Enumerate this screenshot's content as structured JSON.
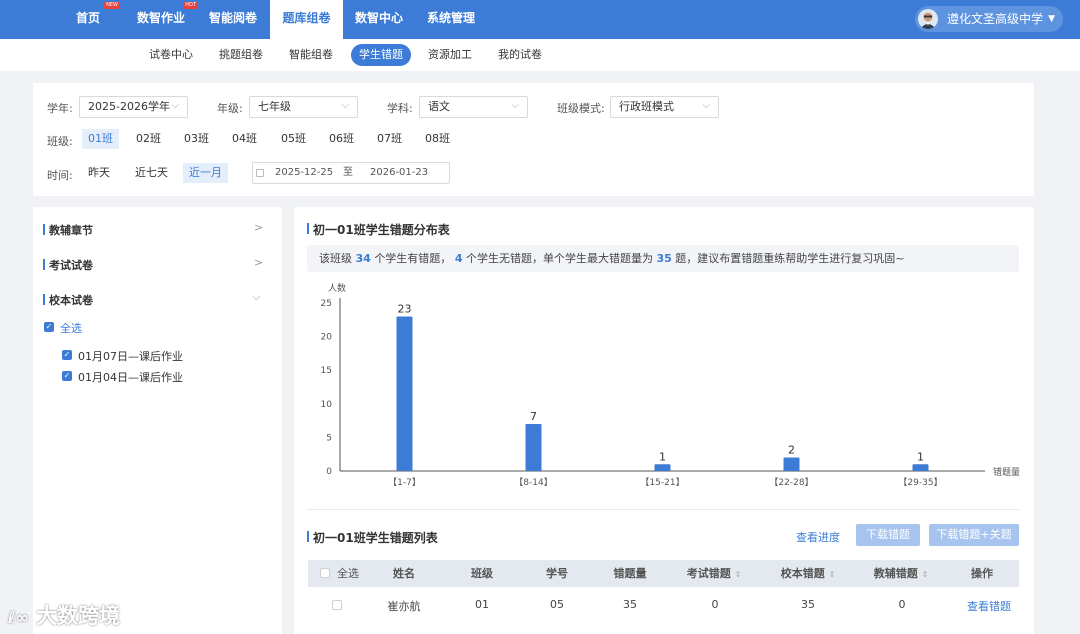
{
  "nav": {
    "items": [
      {
        "label": "首页",
        "badge": "NEW"
      },
      {
        "label": "数智作业",
        "badge": "HOT"
      },
      {
        "label": "智能阅卷",
        "badge": ""
      },
      {
        "label": "题库组卷",
        "badge": ""
      },
      {
        "label": "数智中心",
        "badge": ""
      },
      {
        "label": "系统管理",
        "badge": ""
      }
    ],
    "active_index": 3,
    "user_name": "遵化文圣高级中学"
  },
  "subnav": {
    "items": [
      "试卷中心",
      "挑题组卷",
      "智能组卷",
      "学生错题",
      "资源加工",
      "我的试卷"
    ],
    "active_index": 3
  },
  "filters": {
    "year_label": "学年:",
    "year_value": "2025-2026学年",
    "grade_label": "年级:",
    "grade_value": "七年级",
    "subject_label": "学科:",
    "subject_value": "语文",
    "mode_label": "班级模式:",
    "mode_value": "行政班模式",
    "class_label": "班级:",
    "classes": [
      "01班",
      "02班",
      "03班",
      "04班",
      "05班",
      "06班",
      "07班",
      "08班"
    ],
    "class_active_index": 0,
    "time_label": "时间:",
    "time_options": [
      "昨天",
      "近七天",
      "近一月"
    ],
    "time_active_index": 2,
    "date_start": "2025-12-25",
    "date_to": "至",
    "date_end": "2026-01-23"
  },
  "left_panel": {
    "sections": [
      "教辅章节",
      "考试试卷",
      "校本试卷"
    ],
    "select_all": "全选",
    "papers": [
      "01月07日—课后作业",
      "01月04日—课后作业"
    ]
  },
  "distribution": {
    "title": "初一01班学生错题分布表",
    "summary": {
      "t1": "该班级",
      "with_errors": "34",
      "t2": "个学生有错题，",
      "without_errors": "4",
      "t3": "个学生无错题，单个学生最大错题量为",
      "max_errors": "35",
      "t4": "题，建议布置错题重练帮助学生进行复习巩固~"
    }
  },
  "chart_data": {
    "type": "bar",
    "categories": [
      "【1-7】",
      "【8-14】",
      "【15-21】",
      "【22-28】",
      "【29-35】"
    ],
    "values": [
      23,
      7,
      1,
      2,
      1
    ],
    "ylabel": "人数",
    "xlabel": "错题量",
    "ylim": [
      0,
      25
    ],
    "yticks": [
      0,
      5,
      10,
      15,
      20,
      25
    ],
    "color": "#3c7cd6",
    "data_labels": true,
    "grid": false
  },
  "list": {
    "title": "初一01班学生错题列表",
    "view_progress": "查看进度",
    "download_errors": "下载错题",
    "download_errors_answers": "下载错题+关题",
    "select_all": "全选",
    "columns": [
      "姓名",
      "班级",
      "学号",
      "错题量",
      "考试错题",
      "校本错题",
      "教辅错题",
      "操作"
    ],
    "rows": [
      {
        "name": "崔亦航",
        "class": "01",
        "id": "05",
        "errors": "35",
        "exam": "0",
        "school": "35",
        "tutor": "0",
        "action": "查看错题"
      }
    ]
  },
  "watermark": "大数跨境"
}
